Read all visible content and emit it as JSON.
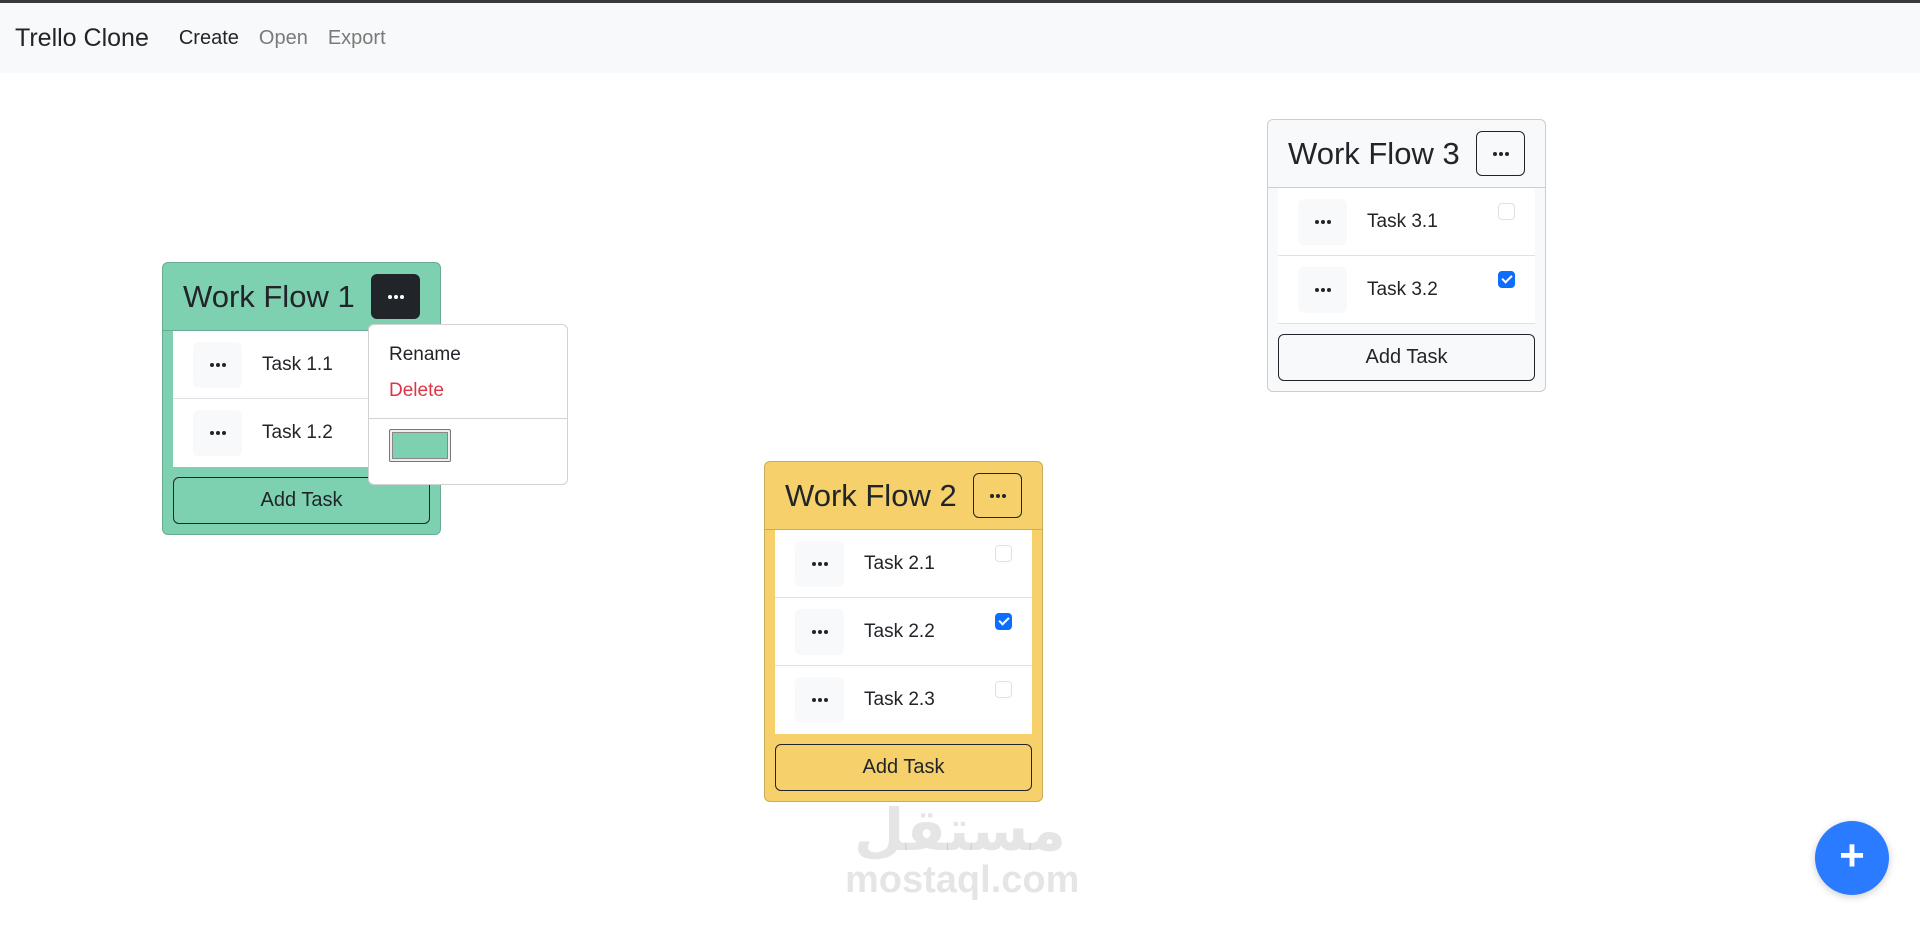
{
  "navbar": {
    "brand": "Trello Clone",
    "links": [
      {
        "label": "Create"
      },
      {
        "label": "Open"
      },
      {
        "label": "Export"
      }
    ]
  },
  "workflows": [
    {
      "title": "Work Flow 1",
      "color": "#7ed1b0",
      "tasks": [
        {
          "label": "Task 1.1"
        },
        {
          "label": "Task 1.2"
        }
      ],
      "add_task_label": "Add Task",
      "menu_open": true
    },
    {
      "title": "Work Flow 2",
      "color": "#f5d06b",
      "tasks": [
        {
          "label": "Task 2.1",
          "checked": false
        },
        {
          "label": "Task 2.2",
          "checked": true
        },
        {
          "label": "Task 2.3",
          "checked": false
        }
      ],
      "add_task_label": "Add Task"
    },
    {
      "title": "Work Flow 3",
      "color": "#f8f9fa",
      "tasks": [
        {
          "label": "Task 3.1",
          "checked": false
        },
        {
          "label": "Task 3.2",
          "checked": true
        }
      ],
      "add_task_label": "Add Task"
    }
  ],
  "dropdown": {
    "rename_label": "Rename",
    "delete_label": "Delete",
    "selected_color": "#7ed1b0"
  },
  "watermark": {
    "arabic": "مستقل",
    "latin": "mostaql.com"
  },
  "fab": {
    "icon": "plus-icon",
    "label": "+"
  }
}
